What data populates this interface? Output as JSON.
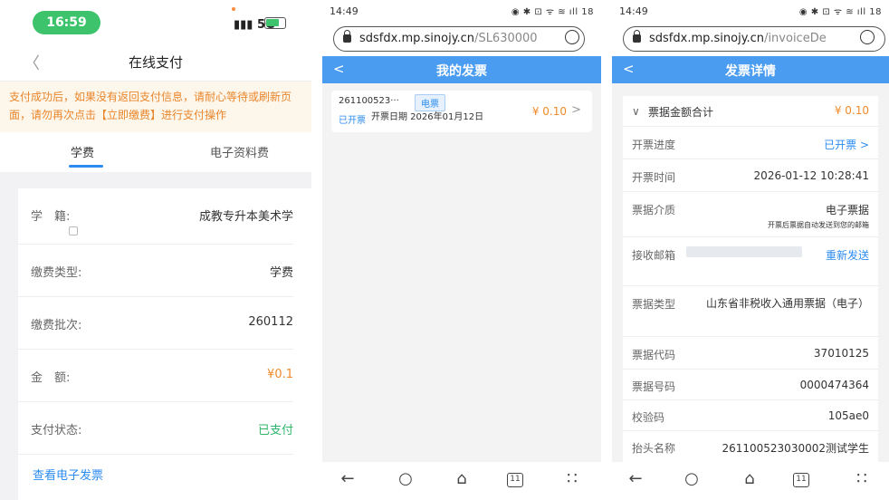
{
  "panel1": {
    "status": {
      "time": "16:59",
      "network": "5G"
    },
    "nav": {
      "title": "在线支付"
    },
    "notice": "支付成功后，如果没有返回支付信息，请耐心等待或刷新页面，请勿再次点击【立即缴费】进行支付操作",
    "tabs": [
      {
        "label": "学费"
      },
      {
        "label": "电子资料费"
      }
    ],
    "rows": [
      {
        "label": "学　籍:",
        "value": "成教专升本美术学"
      },
      {
        "label": "缴费类型:",
        "value": "学费"
      },
      {
        "label": "缴费批次:",
        "value": "260112"
      },
      {
        "label": "金　额:",
        "value": "¥0.1"
      },
      {
        "label": "支付状态:",
        "value": "已支付"
      }
    ],
    "link": "查看电子发票",
    "colors": {
      "accent": "#2d8cf0",
      "paid": "#2fb56a",
      "amount": "#f18a2a"
    }
  },
  "panel2": {
    "status": {
      "time": "14:49",
      "icons": "◉ ✱ ⊡ ᯤ ≋ ıll 18"
    },
    "url": {
      "host": "sdsfdx.mp.sinojy.cn",
      "path": "/SL630000"
    },
    "header": {
      "title": "我的发票"
    },
    "invoice": {
      "number": "261100523···",
      "badge": "电票",
      "status": "已开票",
      "date": "开票日期 2026年01月12日",
      "amount": "¥ 0.10"
    },
    "tab_count": "11"
  },
  "panel3": {
    "status": {
      "time": "14:49",
      "icons": "◉ ✱ ⊡ ᯤ ≋ ıll 18"
    },
    "url": {
      "host": "sdsfdx.mp.sinojy.cn",
      "path": "/invoiceDe"
    },
    "header": {
      "title": "发票详情"
    },
    "total": {
      "label": "票据金额合计",
      "value": "¥ 0.10"
    },
    "rows": {
      "progress": {
        "label": "开票进度",
        "value": "已开票 >"
      },
      "time": {
        "label": "开票时间",
        "value": "2026-01-12 10:28:41"
      },
      "medium": {
        "label": "票据介质",
        "value": "电子票据",
        "sub": "开票后票据自动发送到您的邮箱"
      },
      "email": {
        "label": "接收邮箱",
        "action": "重新发送"
      },
      "type": {
        "label": "票据类型",
        "value": "山东省非税收入通用票据（电子）"
      },
      "code": {
        "label": "票据代码",
        "value": "37010125"
      },
      "number": {
        "label": "票据号码",
        "value": "0000474364"
      },
      "check": {
        "label": "校验码",
        "value": "105ae0"
      },
      "title": {
        "label": "抬头名称",
        "value": "261100523030002测试学生"
      }
    },
    "tab_count": "11"
  }
}
